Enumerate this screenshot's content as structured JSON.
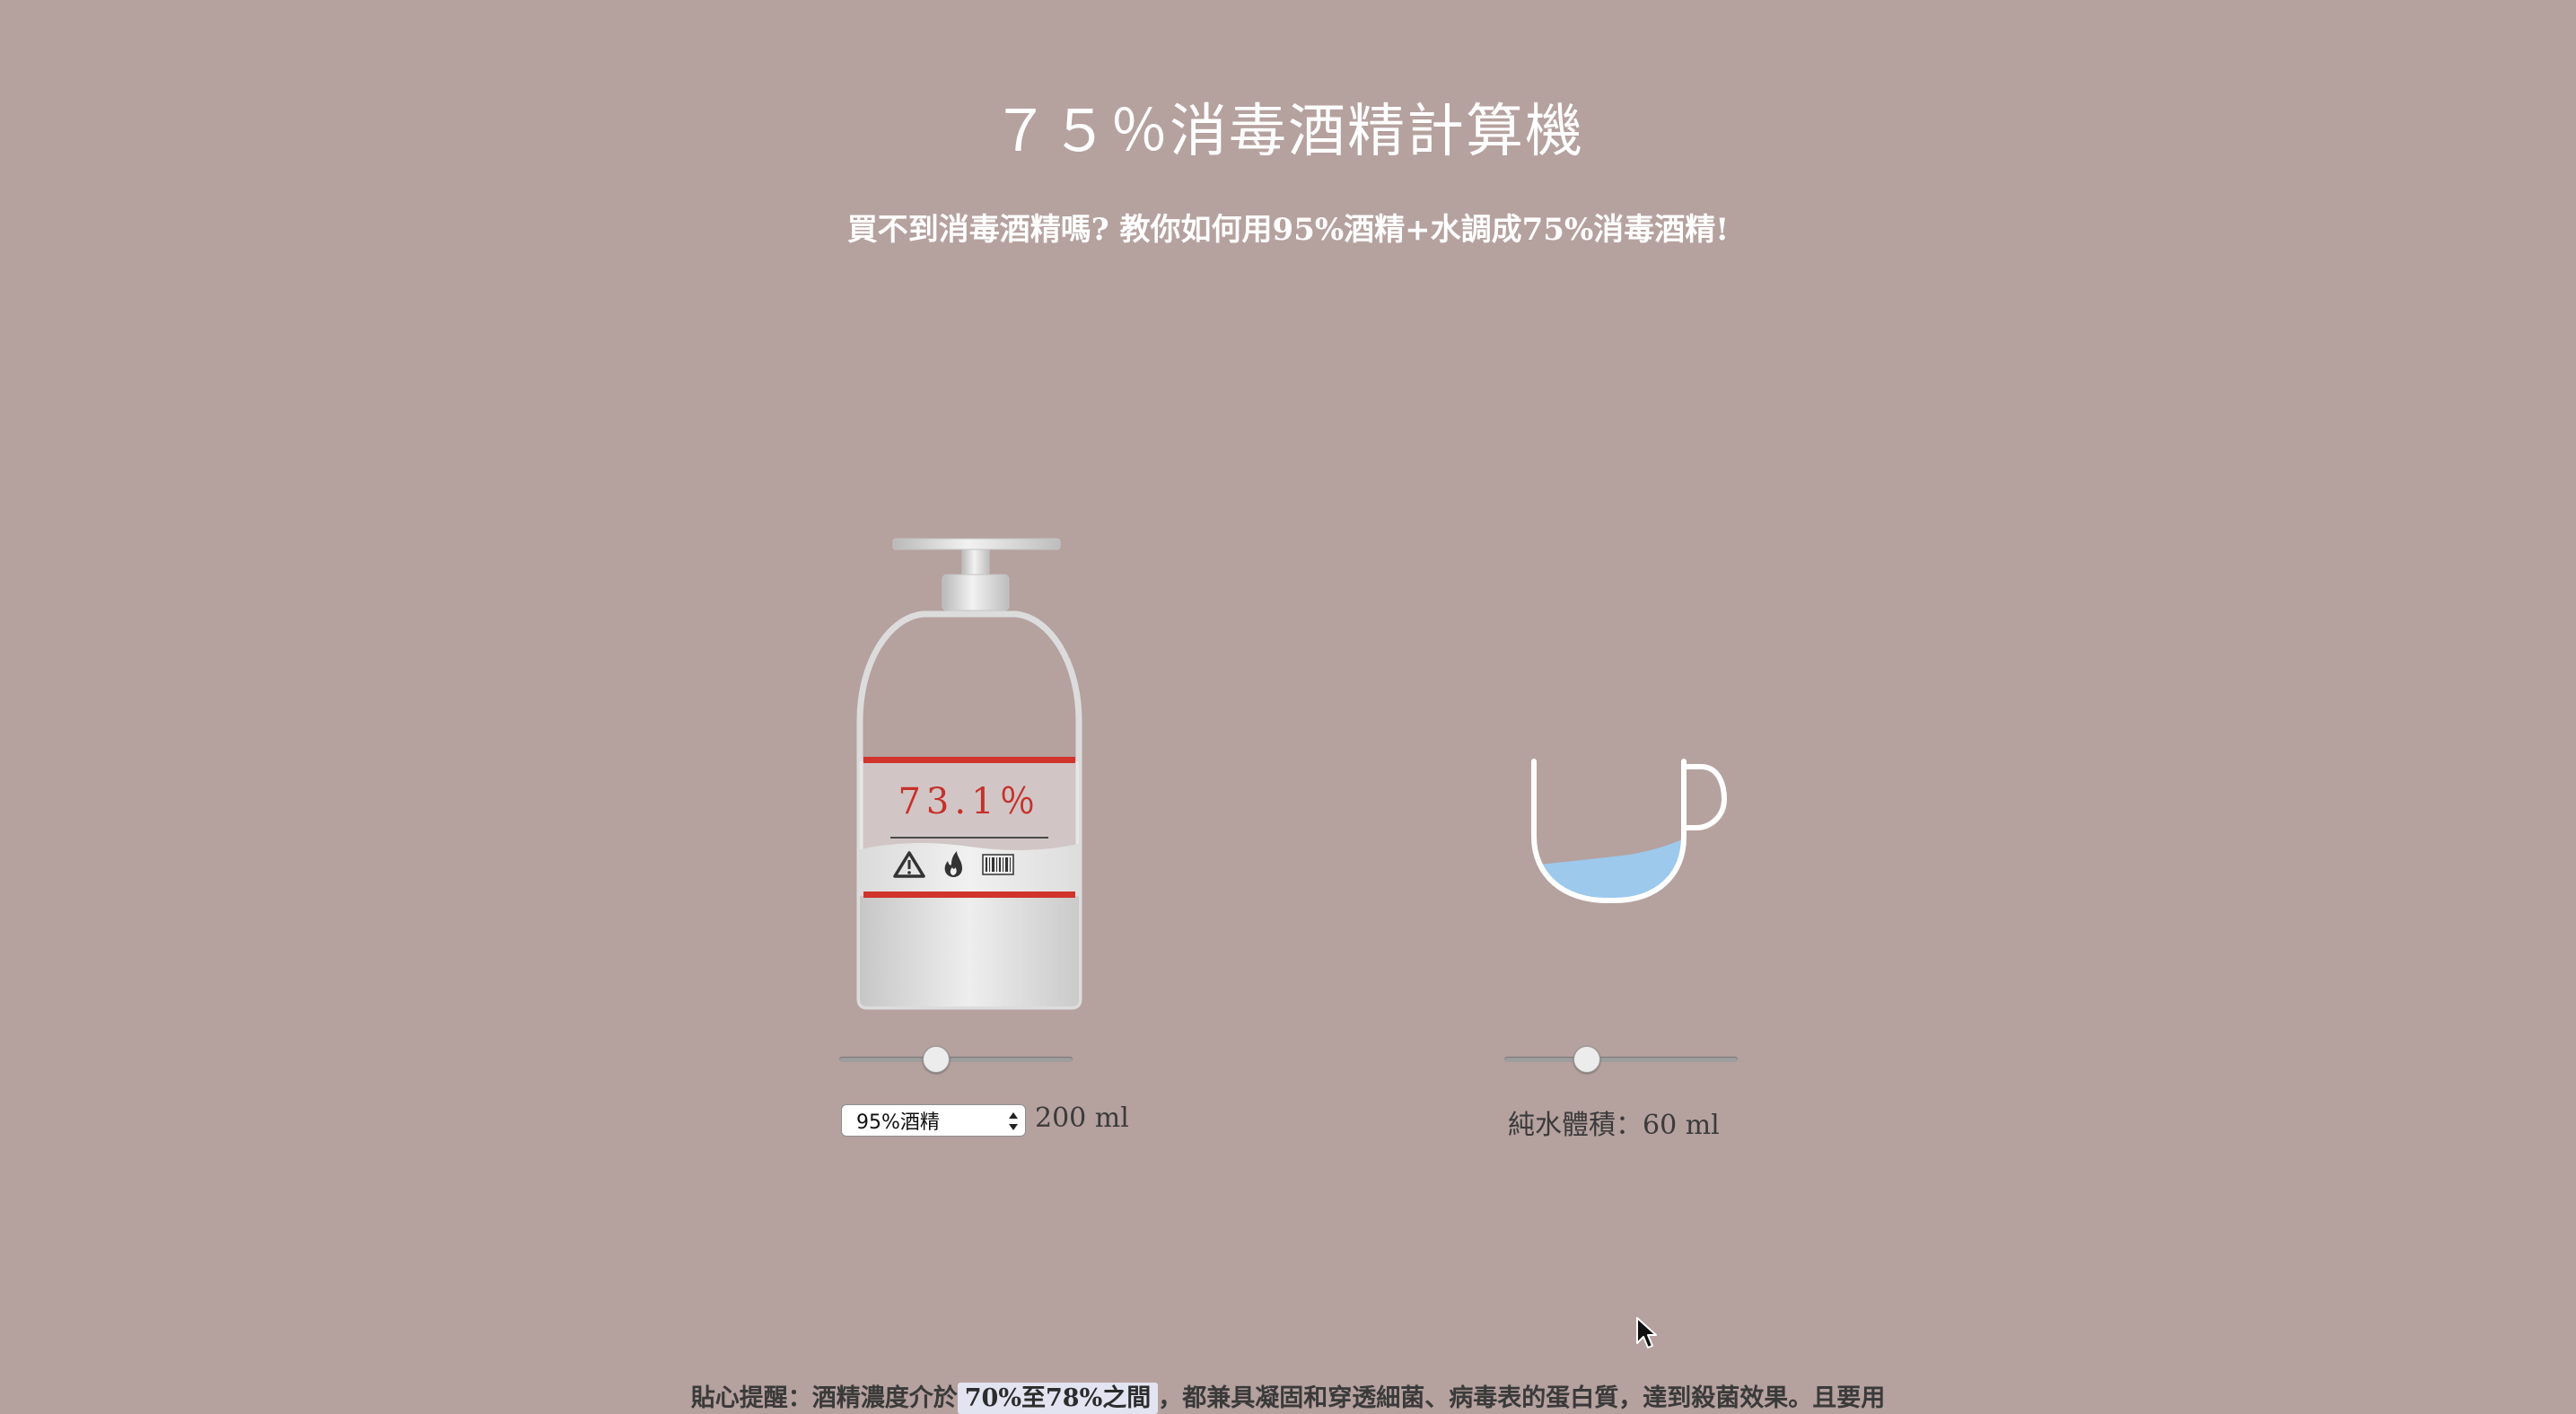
{
  "header": {
    "title": "７５％消毒酒精計算機",
    "subtitle": "買不到消毒酒精嗎? 教你如何用95%酒精+水調成75%消毒酒精!"
  },
  "bottle": {
    "label_percent": "73.1％",
    "label_icons": [
      "warning-icon",
      "flame-icon",
      "barcode-icon"
    ],
    "colors": {
      "stripe": "#d0342c",
      "text": "#c8302a",
      "body": "#d6d6d6"
    }
  },
  "alcohol_control": {
    "slider_value_fraction": 0.4,
    "selected_option": "95%酒精",
    "volume_text": "200 ml"
  },
  "water_control": {
    "slider_value_fraction": 0.33,
    "volume_text": "純水體積：60 ml",
    "water_color": "#9cc9ec"
  },
  "tip": {
    "prefix": "貼心提醒：酒精濃度介於",
    "highlight": "70%至78%之間",
    "suffix": "，都兼具凝固和穿透細菌、病毒表的蛋白質，達到殺菌效果。且要用"
  }
}
